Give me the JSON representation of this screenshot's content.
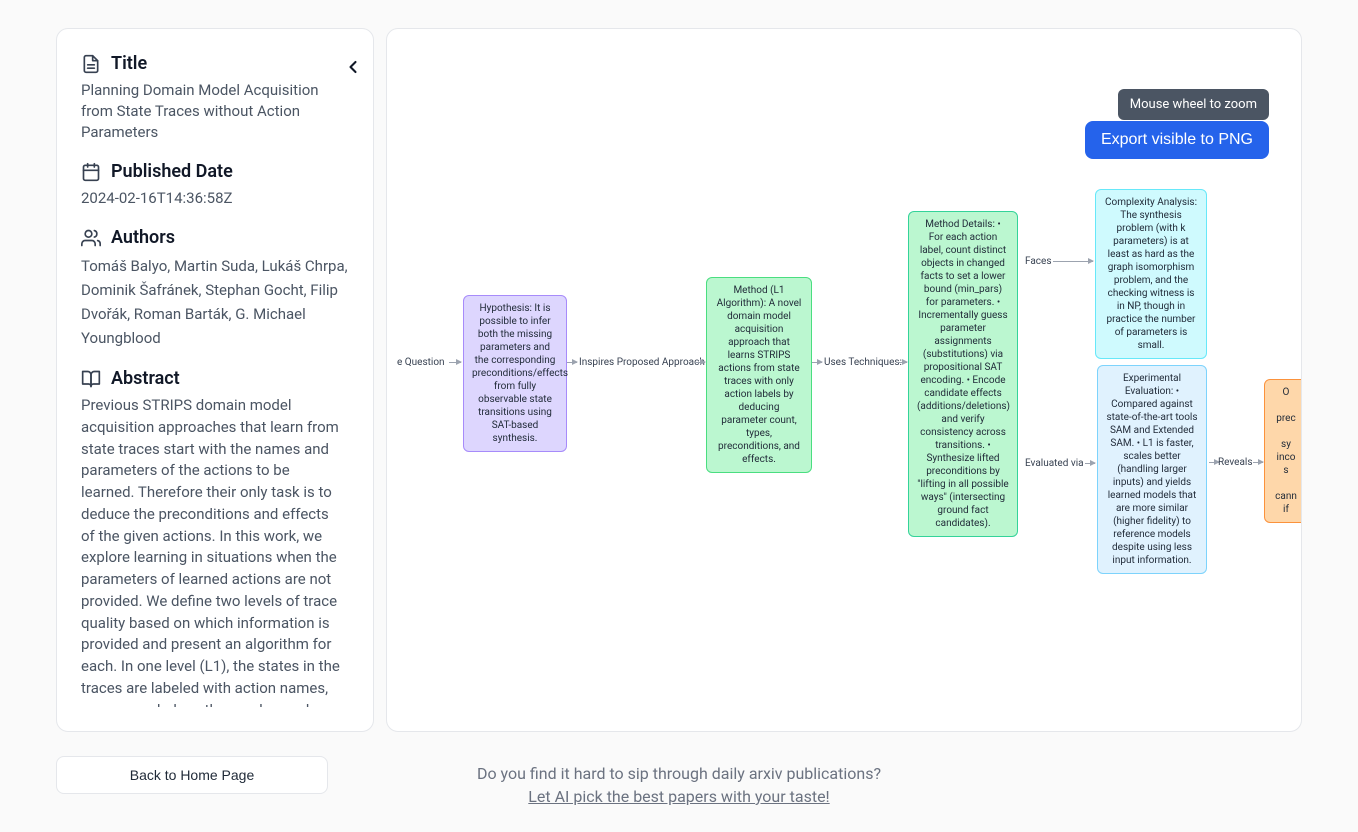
{
  "sidebar": {
    "title_label": "Title",
    "title_value": "Planning Domain Model Acquisition from State Traces without Action Parameters",
    "date_label": "Published Date",
    "date_value": "2024-02-16T14:36:58Z",
    "authors_label": "Authors",
    "authors": [
      "Tomáš Balyo",
      "Martin Suda",
      "Lukáš Chrpa",
      "Dominik Šafránek",
      "Stephan Gocht",
      "Filip Dvořák",
      "Roman Barták",
      "G. Michael Youngblood"
    ],
    "abstract_label": "Abstract",
    "abstract_value": "Previous STRIPS domain model acquisition approaches that learn from state traces start with the names and parameters of the actions to be learned. Therefore their only task is to deduce the preconditions and effects of the given actions. In this work, we explore learning in situations when the parameters of learned actions are not provided. We define two levels of trace quality based on which information is provided and present an algorithm for each. In one level (L1), the states in the traces are labeled with action names, so we can deduce the number and names of the actions."
  },
  "canvas": {
    "tooltip": "Mouse wheel to zoom",
    "export_label": "Export visible to PNG",
    "edge_prefix": "e Question",
    "edges": {
      "e1": "Inspires Proposed Approach",
      "e2": "Uses Techniques:",
      "e3": "Faces",
      "e4": "Evaluated via",
      "e5": "Reveals"
    },
    "nodes": {
      "hypothesis": "Hypothesis:\nIt is\npossible to infer both the missing parameters and the\ncorresponding preconditions/effects from fully observable state transitions using SAT-based synthesis.",
      "method": "Method (L1 Algorithm):\nA\nnovel domain model acquisition approach that learns STRIPS actions\nfrom state traces with only action labels by deducing parameter count,\ntypes, preconditions, and effects.",
      "details": "Method Details:\n• For\neach action label, count distinct objects in changed facts to set a lower bound (min_pars) for parameters.\n•\nIncrementally guess parameter assignments (substitutions) via propositional SAT encoding.\n• Encode\ncandidate effects (additions/deletions) and verify consistency across transitions.\n• Synthesize\nlifted preconditions by \"lifting in all possible ways\" (intersecting ground fact candidates).",
      "complexity": "Complexity Analysis:\nThe\nsynthesis problem (with k parameters) is at least as hard as the graph isomorphism problem, and\nthe checking witness is in NP, though in practice the number of parameters is small.",
      "eval": "Experimental Evaluation:\n• Compared\nagainst state-of-the-art tools SAM and Extended SAM.\n• L1 is faster,\nscales better (handling larger inputs) and yields learned models that are\nmore similar (higher fidelity) to reference models despite using less input information.",
      "orange_partial": "O\n\nprec\n\nsy\ninco\ns\n\ncann\nif"
    }
  },
  "footer": {
    "home_label": "Back to Home Page",
    "promo_q": "Do you find it hard to sip through daily arxiv publications?",
    "promo_link": "Let AI pick the best papers with your taste!"
  }
}
